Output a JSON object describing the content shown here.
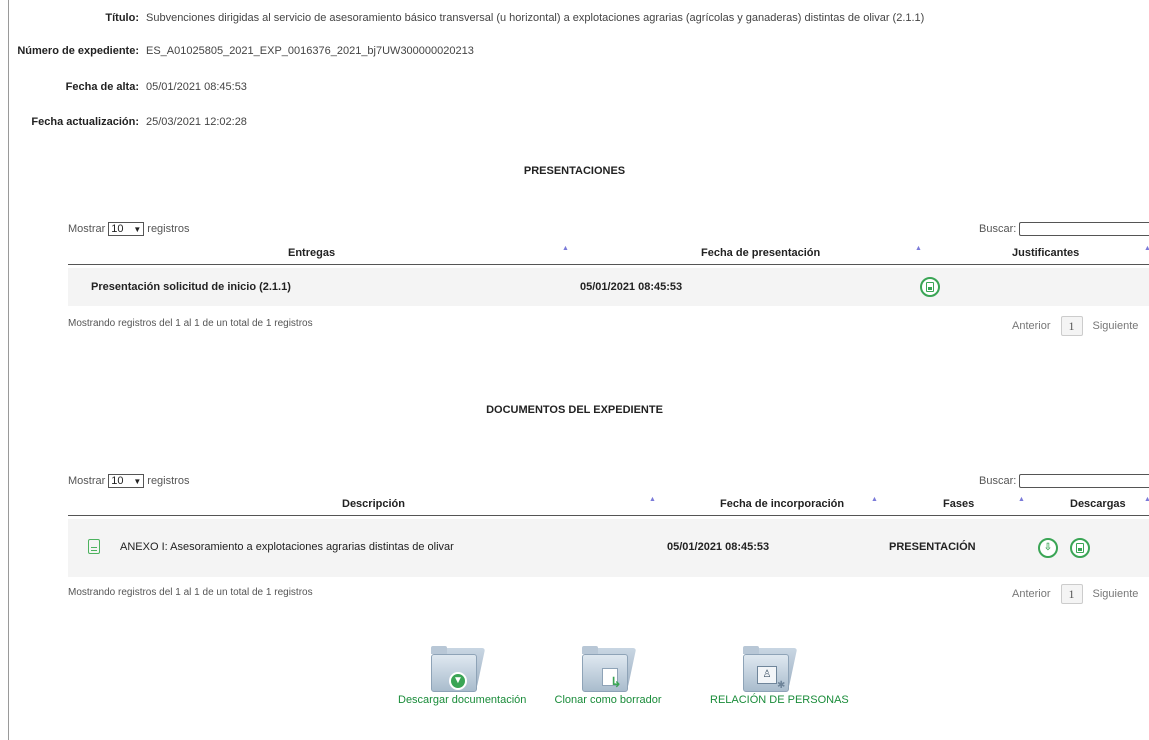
{
  "meta": {
    "titulo": {
      "label": "Título:",
      "value": "Subvenciones dirigidas al servicio de asesoramiento básico transversal (u horizontal) a explotaciones agrarias (agrícolas y ganaderas) distintas de olivar (2.1.1)"
    },
    "expediente": {
      "label": "Número de expediente:",
      "value": "ES_A01025805_2021_EXP_0016376_2021_bj7UW300000020213"
    },
    "alta": {
      "label": "Fecha de alta:",
      "value": "05/01/2021 08:45:53"
    },
    "actualizacion": {
      "label": "Fecha actualización:",
      "value": "25/03/2021 12:02:28"
    }
  },
  "presentaciones": {
    "title": "PRESENTACIONES",
    "length": {
      "prefix": "Mostrar",
      "value": "10",
      "suffix": "registros"
    },
    "search_label": "Buscar:",
    "columns": [
      "Entregas",
      "Fecha de presentación",
      "Justificantes"
    ],
    "rows": [
      {
        "entrega": "Presentación solicitud de inicio (2.1.1)",
        "fecha": "05/01/2021 08:45:53",
        "justificante_icon": "document-download-icon"
      }
    ],
    "info": "Mostrando registros del 1 al 1 de un total de 1 registros",
    "pager": {
      "prev": "Anterior",
      "page": "1",
      "next": "Siguiente"
    }
  },
  "documentos": {
    "title": "DOCUMENTOS DEL EXPEDIENTE",
    "length": {
      "prefix": "Mostrar",
      "value": "10",
      "suffix": "registros"
    },
    "search_label": "Buscar:",
    "columns": [
      "Descripción",
      "Fecha de incorporación",
      "Fases",
      "Descargas"
    ],
    "rows": [
      {
        "descripcion": "ANEXO I: Asesoramiento a explotaciones agrarias distintas de olivar",
        "fecha": "05/01/2021 08:45:53",
        "fase": "PRESENTACIÓN"
      }
    ],
    "info": "Mostrando registros del 1 al 1 de un total de 1 registros",
    "pager": {
      "prev": "Anterior",
      "page": "1",
      "next": "Siguiente"
    }
  },
  "actions": [
    {
      "label": "Descargar documentación",
      "icon": "folder-download-icon"
    },
    {
      "label": "Clonar como borrador",
      "icon": "folder-clone-icon"
    },
    {
      "label": "RELACIÓN DE PERSONAS",
      "icon": "folder-people-icon"
    }
  ],
  "colors": {
    "accent_green": "#3aa555",
    "link_green": "#1a8c3a",
    "sort_arrow": "#7b7bd9",
    "row_bg": "#f4f4f4"
  }
}
